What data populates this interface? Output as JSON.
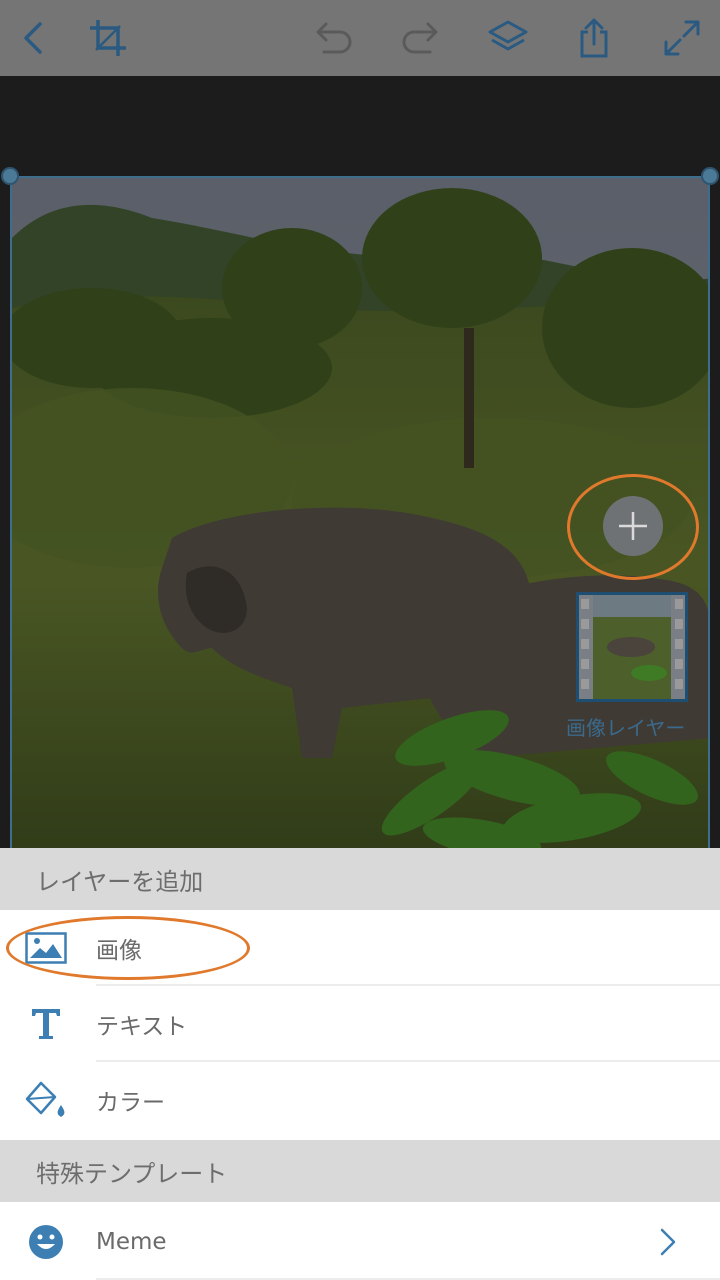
{
  "toolbar": {
    "icons": [
      "back-icon",
      "crop-icon",
      "undo-icon",
      "redo-icon",
      "layers-icon",
      "share-icon",
      "expand-icon"
    ]
  },
  "canvas": {
    "layer_thumbnail_label": "画像レイヤー"
  },
  "sheet": {
    "add_layer_header": "レイヤーを追加",
    "items": [
      {
        "label": "画像",
        "icon": "image-icon"
      },
      {
        "label": "テキスト",
        "icon": "text-icon"
      },
      {
        "label": "カラー",
        "icon": "paint-bucket-icon"
      }
    ],
    "special_templates_header": "特殊テンプレート",
    "templates": [
      {
        "label": "Meme",
        "icon": "smiley-icon"
      }
    ]
  },
  "colors": {
    "accent": "#3d7fb3",
    "highlight": "#e0792c",
    "toolbar_bg": "#757575",
    "section_bg": "#d9d9d9"
  }
}
